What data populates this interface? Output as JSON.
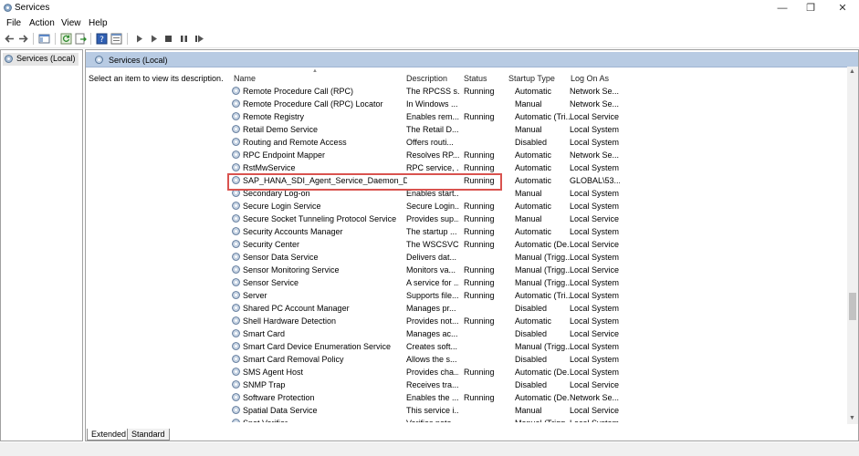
{
  "window": {
    "title": "Services"
  },
  "menu": [
    "File",
    "Action",
    "View",
    "Help"
  ],
  "tree": {
    "item": "Services (Local)"
  },
  "main": {
    "header": "Services (Local)",
    "description": "Select an item to view its description."
  },
  "columns": {
    "name": "Name",
    "description": "Description",
    "status": "Status",
    "startup": "Startup Type",
    "logon": "Log On As"
  },
  "services": [
    {
      "name": "Remote Procedure Call (RPC)",
      "description": "The RPCSS s...",
      "status": "Running",
      "startup": "Automatic",
      "logon": "Network Se..."
    },
    {
      "name": "Remote Procedure Call (RPC) Locator",
      "description": "In Windows ...",
      "status": "",
      "startup": "Manual",
      "logon": "Network Se..."
    },
    {
      "name": "Remote Registry",
      "description": "Enables rem...",
      "status": "Running",
      "startup": "Automatic (Tri...",
      "logon": "Local Service"
    },
    {
      "name": "Retail Demo Service",
      "description": "The Retail D...",
      "status": "",
      "startup": "Manual",
      "logon": "Local System"
    },
    {
      "name": "Routing and Remote Access",
      "description": "Offers routi...",
      "status": "",
      "startup": "Disabled",
      "logon": "Local System"
    },
    {
      "name": "RPC Endpoint Mapper",
      "description": "Resolves RP...",
      "status": "Running",
      "startup": "Automatic",
      "logon": "Network Se..."
    },
    {
      "name": "RstMwService",
      "description": "RPC service, ...",
      "status": "Running",
      "startup": "Automatic",
      "logon": "Local System"
    },
    {
      "name": "SAP_HANA_SDI_Agent_Service_Daemon_DPA...",
      "description": "",
      "status": "Running",
      "startup": "Automatic",
      "logon": "GLOBAL\\53..."
    },
    {
      "name": "Secondary Log-on",
      "description": "Enables start...",
      "status": "",
      "startup": "Manual",
      "logon": "Local System"
    },
    {
      "name": "Secure Login Service",
      "description": "Secure Login...",
      "status": "Running",
      "startup": "Automatic",
      "logon": "Local System"
    },
    {
      "name": "Secure Socket Tunneling Protocol Service",
      "description": "Provides sup...",
      "status": "Running",
      "startup": "Manual",
      "logon": "Local Service"
    },
    {
      "name": "Security Accounts Manager",
      "description": "The startup ...",
      "status": "Running",
      "startup": "Automatic",
      "logon": "Local System"
    },
    {
      "name": "Security Center",
      "description": "The WSCSVC...",
      "status": "Running",
      "startup": "Automatic (De...",
      "logon": "Local Service"
    },
    {
      "name": "Sensor Data Service",
      "description": "Delivers dat...",
      "status": "",
      "startup": "Manual (Trigg...",
      "logon": "Local System"
    },
    {
      "name": "Sensor Monitoring Service",
      "description": "Monitors va...",
      "status": "Running",
      "startup": "Manual (Trigg...",
      "logon": "Local Service"
    },
    {
      "name": "Sensor Service",
      "description": "A service for ...",
      "status": "Running",
      "startup": "Manual (Trigg...",
      "logon": "Local System"
    },
    {
      "name": "Server",
      "description": "Supports file...",
      "status": "Running",
      "startup": "Automatic (Tri...",
      "logon": "Local System"
    },
    {
      "name": "Shared PC Account Manager",
      "description": "Manages pr...",
      "status": "",
      "startup": "Disabled",
      "logon": "Local System"
    },
    {
      "name": "Shell Hardware Detection",
      "description": "Provides not...",
      "status": "Running",
      "startup": "Automatic",
      "logon": "Local System"
    },
    {
      "name": "Smart Card",
      "description": "Manages ac...",
      "status": "",
      "startup": "Disabled",
      "logon": "Local Service"
    },
    {
      "name": "Smart Card Device Enumeration Service",
      "description": "Creates soft...",
      "status": "",
      "startup": "Manual (Trigg...",
      "logon": "Local System"
    },
    {
      "name": "Smart Card Removal Policy",
      "description": "Allows the s...",
      "status": "",
      "startup": "Disabled",
      "logon": "Local System"
    },
    {
      "name": "SMS Agent Host",
      "description": "Provides cha...",
      "status": "Running",
      "startup": "Automatic (De...",
      "logon": "Local System"
    },
    {
      "name": "SNMP Trap",
      "description": "Receives tra...",
      "status": "",
      "startup": "Disabled",
      "logon": "Local Service"
    },
    {
      "name": "Software Protection",
      "description": "Enables the ...",
      "status": "Running",
      "startup": "Automatic (De...",
      "logon": "Network Se..."
    },
    {
      "name": "Spatial Data Service",
      "description": "This service i...",
      "status": "",
      "startup": "Manual",
      "logon": "Local Service"
    },
    {
      "name": "Spot Verifier",
      "description": "Verifies pote...",
      "status": "",
      "startup": "Manual (Trigg...",
      "logon": "Local System"
    }
  ],
  "tabs": [
    "Extended",
    "Standard"
  ],
  "colors": {
    "highlight": "#d9534f",
    "header_bg": "#b8cbe3"
  }
}
